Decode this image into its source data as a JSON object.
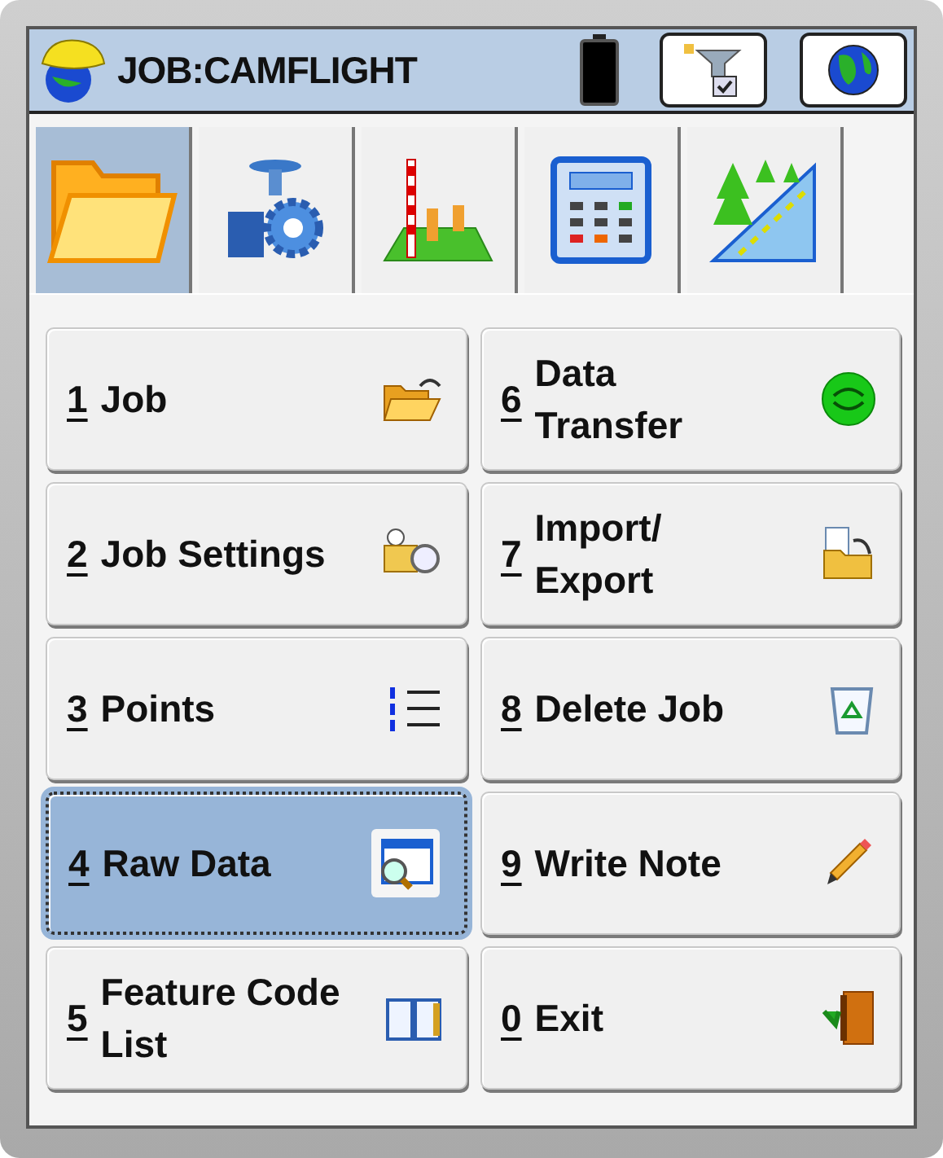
{
  "window": {
    "title": "JOB:CAMFLIGHT"
  },
  "title_buttons": [
    {
      "kind": "filter-check"
    },
    {
      "kind": "globe"
    }
  ],
  "tabs": [
    {
      "kind": "folder",
      "selected": true
    },
    {
      "kind": "instrument",
      "selected": false
    },
    {
      "kind": "level",
      "selected": false
    },
    {
      "kind": "calculator",
      "selected": false
    },
    {
      "kind": "road",
      "selected": false
    }
  ],
  "menu": [
    {
      "key": "1",
      "lines": [
        "Job"
      ],
      "kind": "folder-open",
      "selected": false
    },
    {
      "key": "2",
      "lines": [
        "Job Settings"
      ],
      "kind": "settings",
      "selected": false
    },
    {
      "key": "3",
      "lines": [
        "Points"
      ],
      "kind": "list",
      "selected": false
    },
    {
      "key": "4",
      "lines": [
        "Raw Data"
      ],
      "kind": "rawdata",
      "selected": true
    },
    {
      "key": "5",
      "lines": [
        "Feature Code",
        "List"
      ],
      "kind": "book",
      "selected": false
    },
    {
      "key": "6",
      "lines": [
        "Data",
        "Transfer"
      ],
      "kind": "sync",
      "selected": false
    },
    {
      "key": "7",
      "lines": [
        "Import/",
        "Export"
      ],
      "kind": "import",
      "selected": false
    },
    {
      "key": "8",
      "lines": [
        "Delete Job"
      ],
      "kind": "bin",
      "selected": false
    },
    {
      "key": "9",
      "lines": [
        "Write Note"
      ],
      "kind": "pencil",
      "selected": false
    },
    {
      "key": "0",
      "lines": [
        "Exit"
      ],
      "kind": "exit",
      "selected": false
    }
  ]
}
